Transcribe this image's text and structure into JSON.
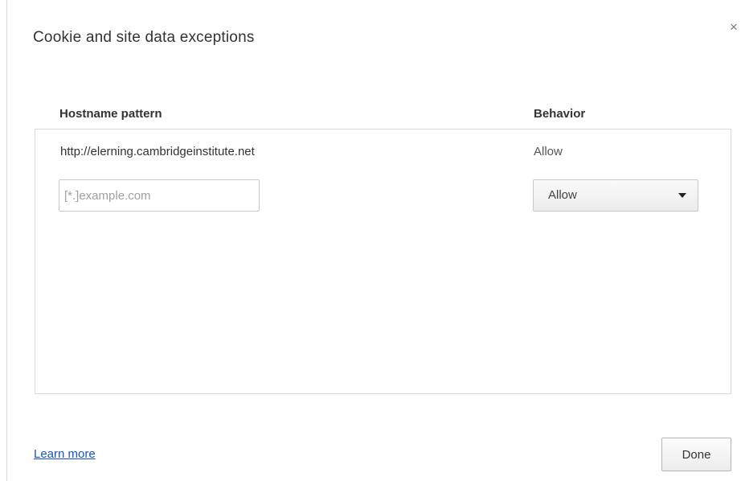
{
  "dialog": {
    "title": "Cookie and site data exceptions",
    "close_label": "×"
  },
  "table": {
    "headers": {
      "hostname": "Hostname pattern",
      "behavior": "Behavior"
    },
    "rows": [
      {
        "hostname": "http://elerning.cambridgeinstitute.net",
        "behavior": "Allow"
      }
    ],
    "new_entry": {
      "hostname_value": "",
      "hostname_placeholder": "[*.]example.com",
      "behavior_selected": "Allow"
    }
  },
  "footer": {
    "learn_more": "Learn more",
    "done": "Done"
  },
  "colors": {
    "link": "#1155cc",
    "border": "#d9d9d9",
    "text": "#333333"
  }
}
